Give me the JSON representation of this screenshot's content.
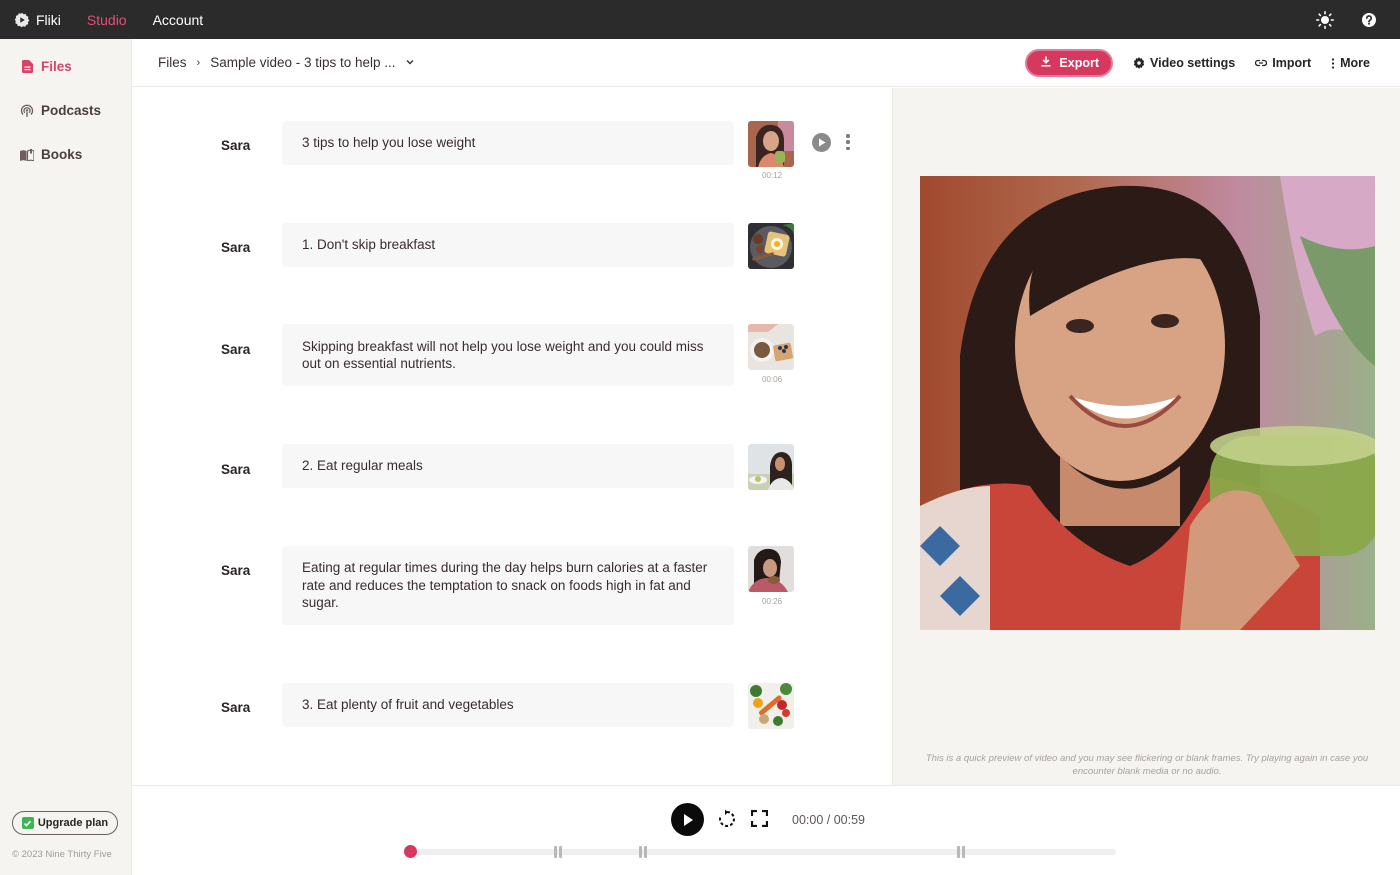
{
  "app": {
    "name": "Fliki",
    "nav": [
      {
        "label": "Studio",
        "active": true
      },
      {
        "label": "Account",
        "active": false
      }
    ],
    "top_icons": [
      "sun-icon",
      "help-icon"
    ],
    "accent_color": "#d7385e"
  },
  "sidebar": {
    "items": [
      {
        "label": "Files",
        "icon": "file-icon",
        "active": true
      },
      {
        "label": "Podcasts",
        "icon": "podcast-icon",
        "active": false
      },
      {
        "label": "Books",
        "icon": "book-icon",
        "active": false
      }
    ],
    "upgrade_label": "Upgrade plan",
    "copyright": "© 2023 Nine Thirty Five"
  },
  "toolbar": {
    "breadcrumb_root": "Files",
    "breadcrumb_current": "Sample video - 3 tips to help ...",
    "export_label": "Export",
    "video_settings_label": "Video settings",
    "import_label": "Import",
    "more_label": "More"
  },
  "scenes": [
    {
      "speaker": "Sara",
      "text": "3 tips to help you lose weight",
      "duration": "00:12",
      "thumb": "woman-smoothie"
    },
    {
      "speaker": "Sara",
      "text": "1. Don't skip breakfast",
      "duration": "",
      "thumb": "breakfast-plate"
    },
    {
      "speaker": "Sara",
      "text": "Skipping breakfast will not help you lose weight and you could miss out on essential nutrients.",
      "duration": "00:06",
      "thumb": "coffee-toast"
    },
    {
      "speaker": "Sara",
      "text": "2. Eat regular meals",
      "duration": "",
      "thumb": "woman-eating"
    },
    {
      "speaker": "Sara",
      "text": "Eating at regular times during the day helps burn calories at a faster rate and reduces the temptation to snack on foods high in fat and sugar.",
      "duration": "00:26",
      "thumb": "girl-eating"
    },
    {
      "speaker": "Sara",
      "text": "3. Eat plenty of fruit and vegetables",
      "duration": "",
      "thumb": "vegetables"
    }
  ],
  "preview": {
    "note": "This is a quick preview of video and you may see flickering or blank frames. Try playing again in case you encounter blank media or no audio."
  },
  "player": {
    "time": "00:00 / 00:59",
    "progress": 0,
    "markers": [
      0.21,
      0.33,
      0.78
    ]
  }
}
